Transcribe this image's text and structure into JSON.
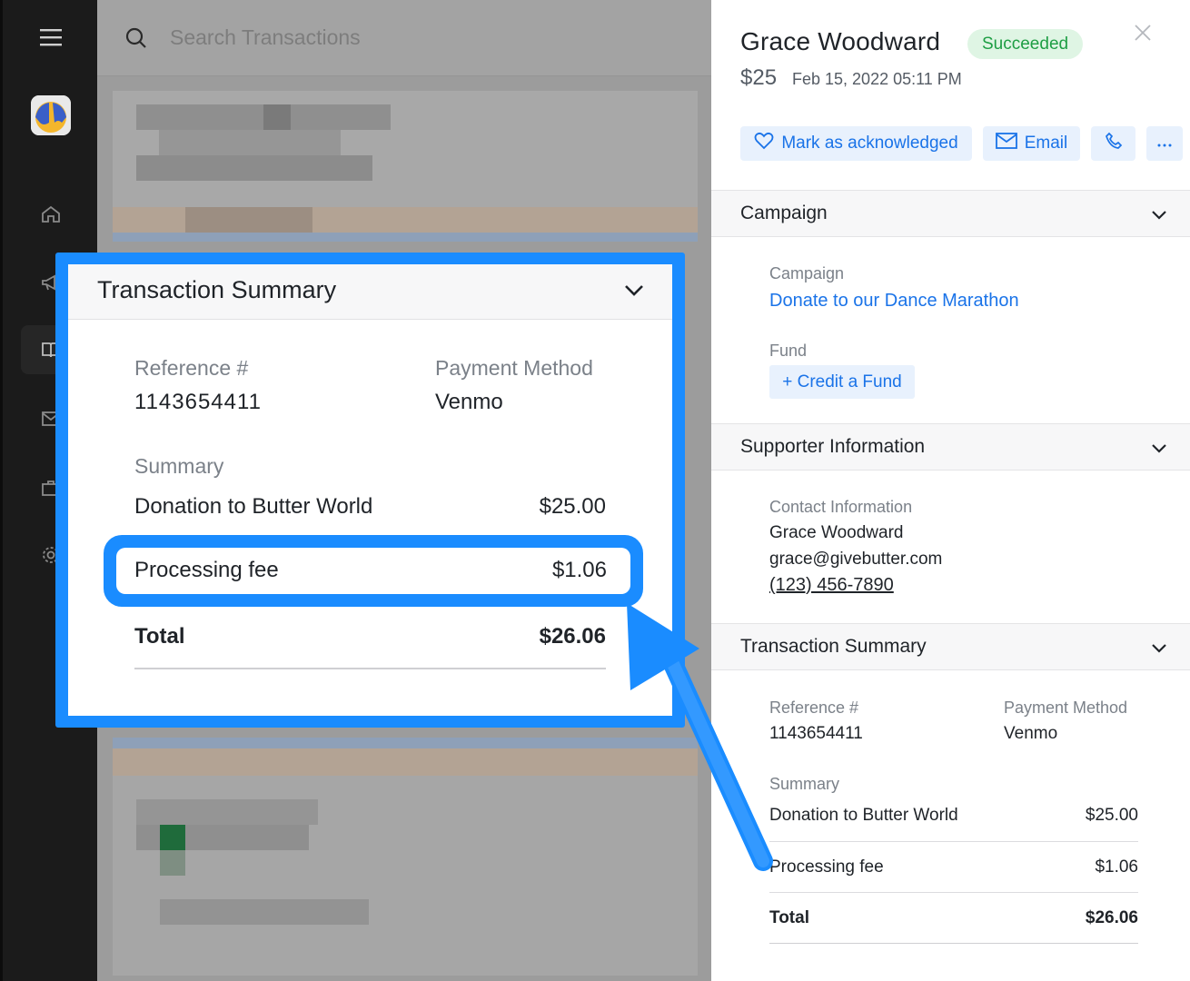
{
  "search": {
    "placeholder": "Search Transactions"
  },
  "rail": {
    "icons": [
      "menu-icon",
      "home-icon",
      "megaphone-icon",
      "book-icon",
      "mail-icon",
      "briefcase-icon",
      "gear-icon"
    ]
  },
  "detail": {
    "name": "Grace Woodward",
    "status": "Succeeded",
    "amount": "$25",
    "datetime": "Feb 15, 2022 05:11 PM",
    "actions": {
      "acknowledge": "Mark as acknowledged",
      "email": "Email"
    },
    "campaign": {
      "section_title": "Campaign",
      "campaign_label": "Campaign",
      "campaign_value": "Donate to our Dance Marathon",
      "fund_label": "Fund",
      "fund_button": "+ Credit a Fund"
    },
    "supporter": {
      "section_title": "Supporter Information",
      "contact_label": "Contact Information",
      "name": "Grace Woodward",
      "email": "grace@givebutter.com",
      "phone": "(123) 456-7890"
    },
    "transaction": {
      "section_title": "Transaction Summary",
      "reference_label": "Reference #",
      "reference_value": "1143654411",
      "payment_label": "Payment Method",
      "payment_value": "Venmo",
      "summary_label": "Summary",
      "donation_label": "Donation to Butter World",
      "donation_value": "$25.00",
      "fee_label": "Processing fee",
      "fee_value": "$1.06",
      "total_label": "Total",
      "total_value": "$26.06"
    }
  },
  "colors": {
    "accent": "#1a73e8",
    "callout": "#1a8cff",
    "success_bg": "#dff5e4",
    "success_text": "#1e9e44"
  }
}
